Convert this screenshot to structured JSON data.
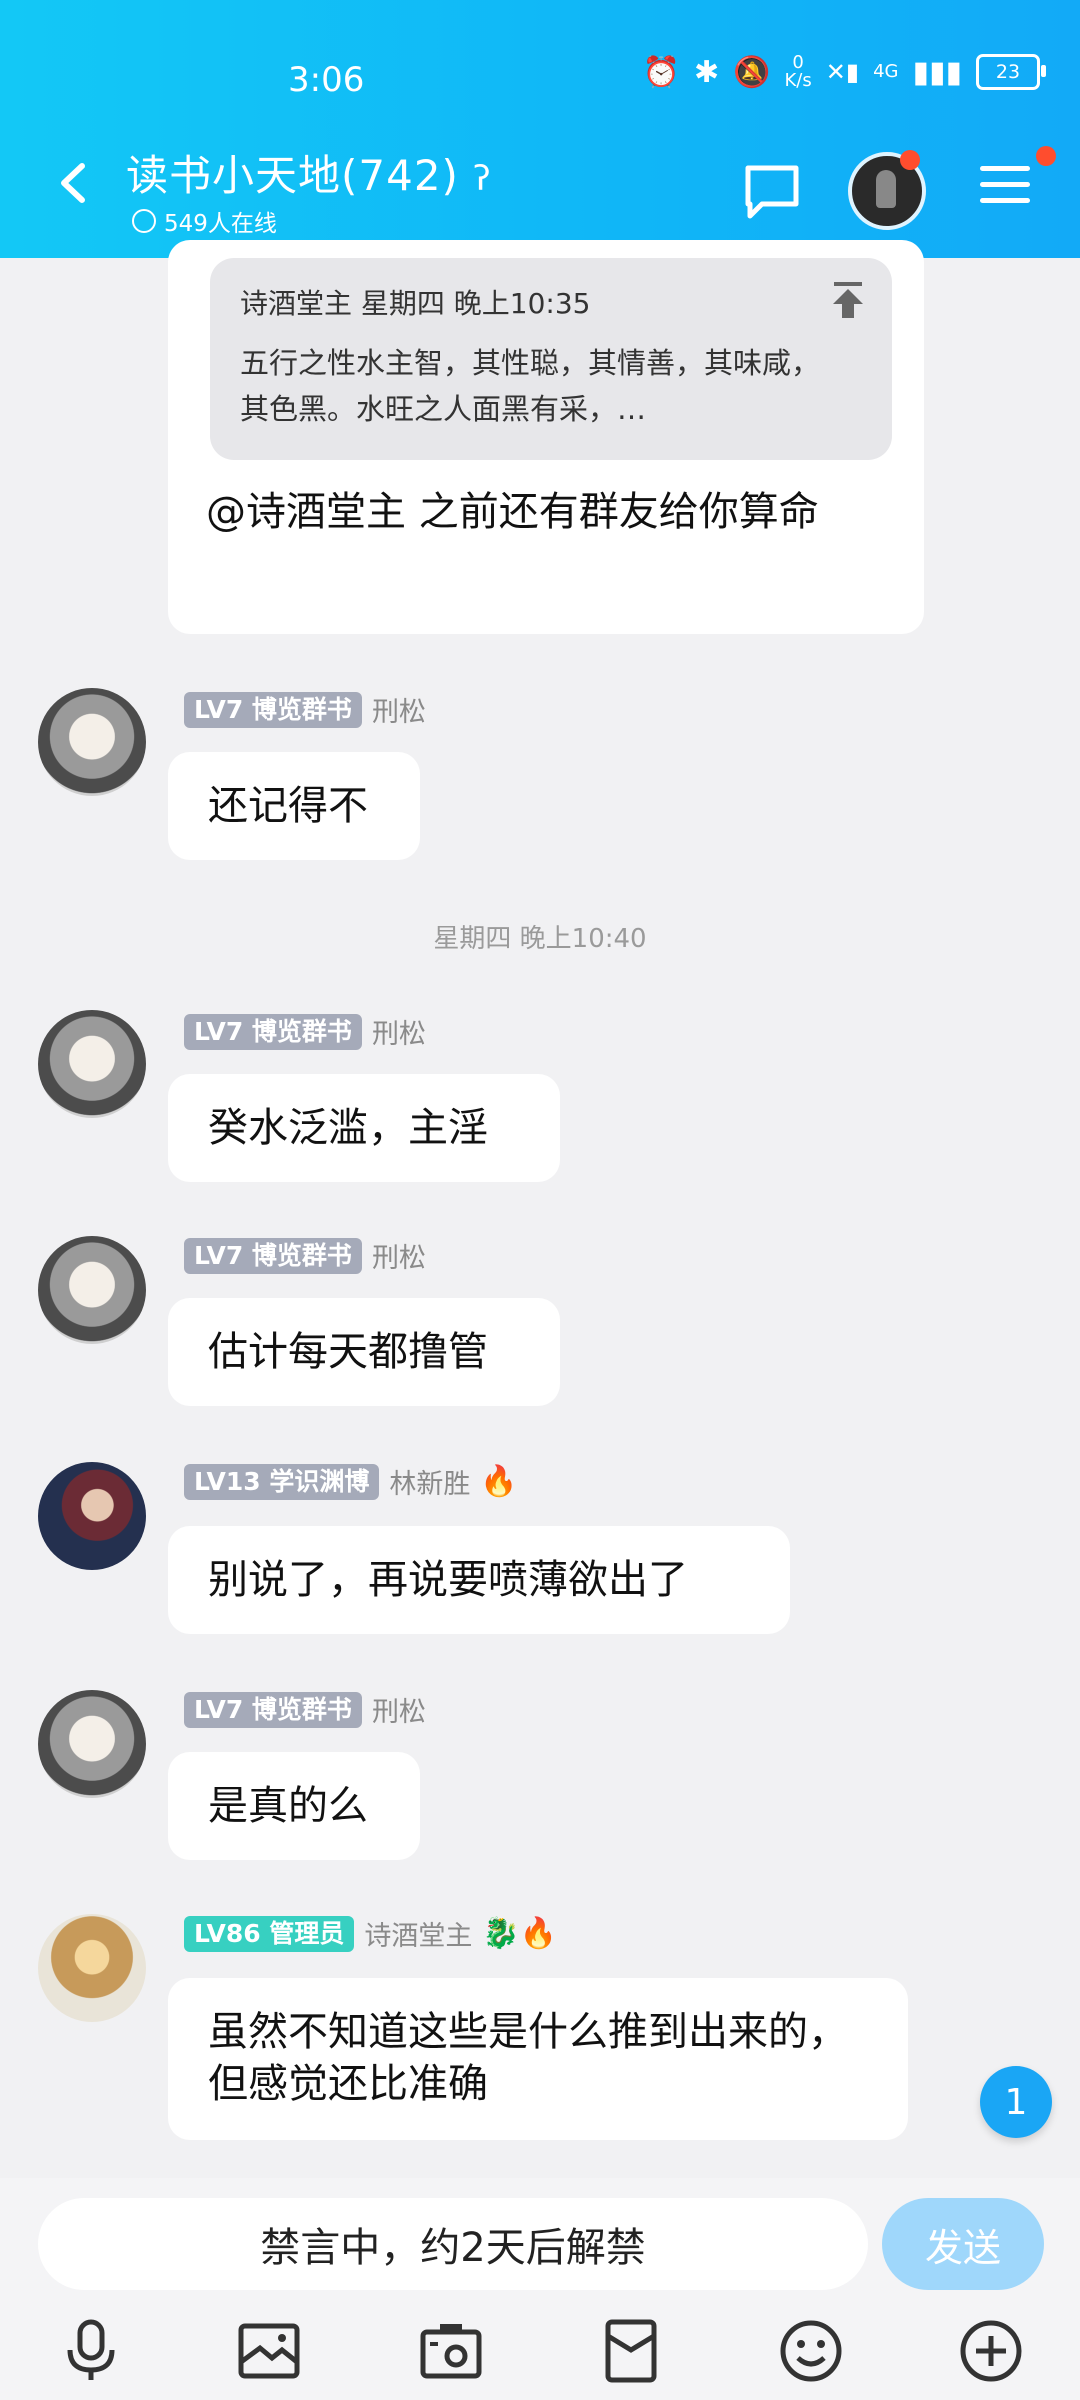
{
  "status": {
    "time": "3:06",
    "net_speed_top": "0",
    "net_speed_bottom": "K/s",
    "network": "4G",
    "battery": "23"
  },
  "header": {
    "title": "读书小天地(742)",
    "online": "549人在线"
  },
  "quote": {
    "author_time": "诗酒堂主 星期四 晚上10:35",
    "text": "五行之性水主智，其性聪，其情善，其味咸，其色黑。水旺之人面黑有采，…"
  },
  "messages": [
    {
      "text": "@诗酒堂主 之前还有群友给你算命"
    },
    {
      "badge": "LV7 博览群书",
      "nick": "刑松",
      "text": "还记得不"
    },
    {
      "time_sep": "星期四 晚上10:40"
    },
    {
      "badge": "LV7 博览群书",
      "nick": "刑松",
      "text": "癸水泛滥，主淫"
    },
    {
      "badge": "LV7 博览群书",
      "nick": "刑松",
      "text": "估计每天都撸管"
    },
    {
      "badge": "LV13 学识渊博",
      "nick": "林新胜",
      "emoji": "🔥",
      "text": "别说了，再说要喷薄欲出了"
    },
    {
      "badge": "LV7 博览群书",
      "nick": "刑松",
      "text": "是真的么"
    },
    {
      "badge": "LV86 管理员",
      "nick": "诗酒堂主",
      "emoji": "🐉🔥",
      "text": "虽然不知道这些是什么推到出来的，但感觉还比准确"
    }
  ],
  "unread_count": "1",
  "input": {
    "placeholder": "禁言中，约2天后解禁",
    "send_label": "发送"
  },
  "toolbar": [
    "mic-icon",
    "image-icon",
    "camera-icon",
    "red-packet-icon",
    "emoji-icon",
    "plus-icon"
  ]
}
